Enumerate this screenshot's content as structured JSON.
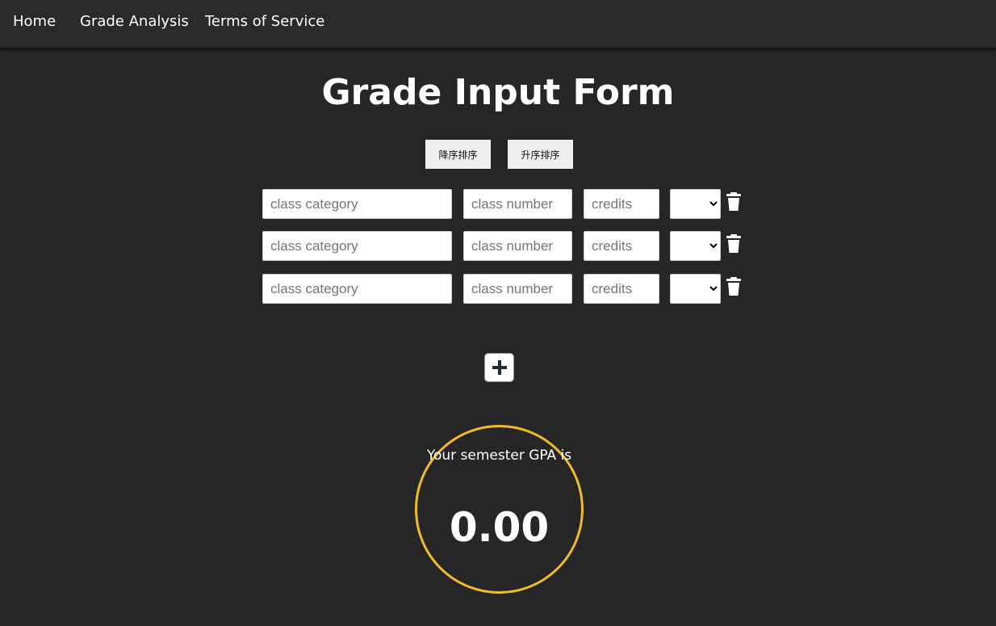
{
  "nav": {
    "home": "Home",
    "grade_analysis": "Grade Analysis",
    "terms": "Terms of Service"
  },
  "page_title": "Grade Input Form",
  "sort": {
    "descending": "降序排序",
    "ascending": "升序排序"
  },
  "rows": [
    {
      "category_placeholder": "class category",
      "number_placeholder": "class number",
      "credits_placeholder": "credits",
      "grade": ""
    },
    {
      "category_placeholder": "class category",
      "number_placeholder": "class number",
      "credits_placeholder": "credits",
      "grade": ""
    },
    {
      "category_placeholder": "class category",
      "number_placeholder": "class number",
      "credits_placeholder": "credits",
      "grade": ""
    }
  ],
  "add_icon": "plus-icon",
  "delete_icon": "trash-icon",
  "gpa": {
    "label": "Your semester GPA is",
    "value": "0.00"
  },
  "colors": {
    "background": "#262626",
    "navbar": "#2a2a2a",
    "gpa_ring": "#f2b92a"
  }
}
